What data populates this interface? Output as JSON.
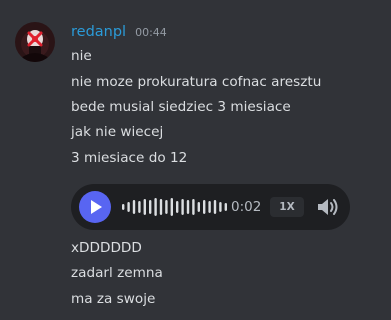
{
  "message": {
    "author": "redanpl",
    "timestamp": "00:44",
    "avatar_icon": "red-cross-skull-avatar-icon",
    "lines_before": [
      "nie",
      "nie moze prokuratura cofnac aresztu",
      "bede musial siedziec 3 miesiace",
      "jak nie wiecej",
      "3 miesiace do 12"
    ],
    "voice_message": {
      "play_icon": "play-icon",
      "duration": "0:02",
      "speed": "1X",
      "volume_icon": "speaker-volume-icon",
      "accent": "#5865f2",
      "played_fraction": 0
    },
    "lines_after": [
      "xDDDDDD",
      "zadarl zemna",
      "ma za swoje"
    ]
  },
  "colors": {
    "background": "#313338",
    "username": "#2b9bd8",
    "text": "#dbdee1",
    "muted": "#949ba4",
    "player_bg": "#1e1f22"
  }
}
